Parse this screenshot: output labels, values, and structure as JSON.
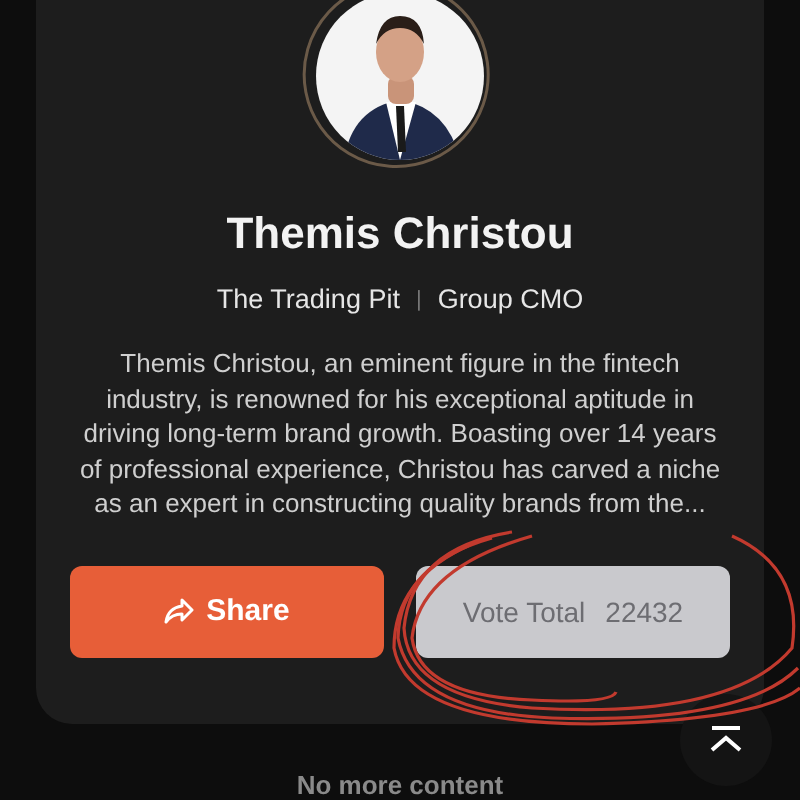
{
  "profile": {
    "name": "Themis Christou",
    "company": "The Trading Pit",
    "separator": "|",
    "role": "Group CMO",
    "bio": "Themis Christou, an eminent figure in the fintech industry, is renowned for his exceptional aptitude in driving long-term brand growth. Boasting over 14 years of professional experience, Christou has carved a niche as an expert in constructing quality brands from the..."
  },
  "share_button": {
    "label": "Share"
  },
  "vote_button": {
    "label": "Vote Total",
    "count": "22432"
  },
  "footer": {
    "text": "No more content"
  }
}
